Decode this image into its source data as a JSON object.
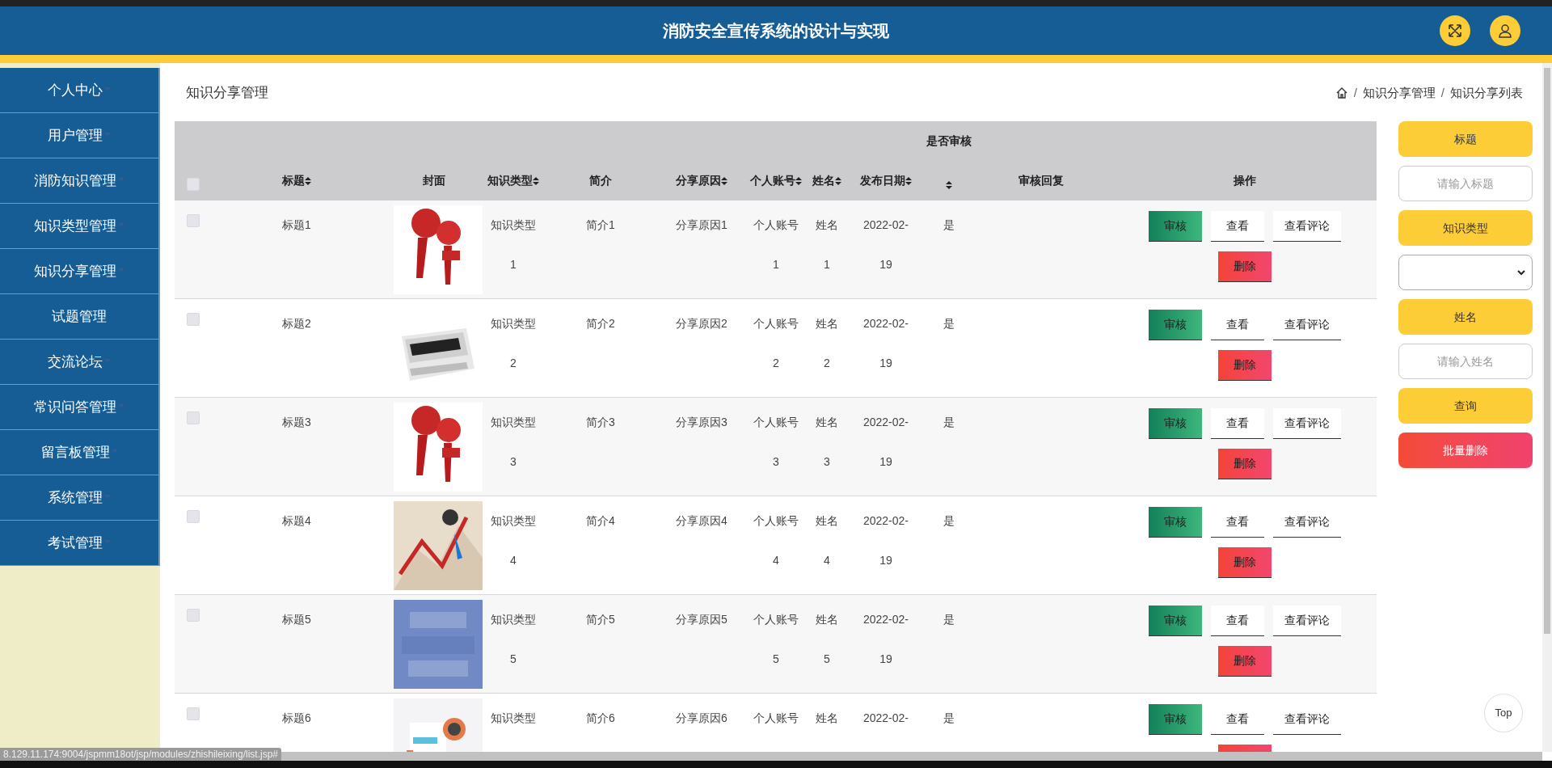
{
  "header": {
    "title": "消防安全宣传系统的设计与实现"
  },
  "sidebar": {
    "items": [
      {
        "label": "个人中心",
        "has_caret": true
      },
      {
        "label": "用户管理",
        "has_caret": true
      },
      {
        "label": "消防知识管理",
        "has_caret": true
      },
      {
        "label": "知识类型管理",
        "has_caret": true
      },
      {
        "label": "知识分享管理",
        "has_caret": true
      },
      {
        "label": "试题管理",
        "has_caret": false
      },
      {
        "label": "交流论坛",
        "has_caret": true
      },
      {
        "label": "常识问答管理",
        "has_caret": true
      },
      {
        "label": "留言板管理",
        "has_caret": true
      },
      {
        "label": "系统管理",
        "has_caret": true
      },
      {
        "label": "考试管理",
        "has_caret": true
      }
    ]
  },
  "page_title": "知识分享管理",
  "breadcrumb": [
    {
      "kind": "separator",
      "text": "/"
    },
    {
      "kind": "link",
      "text": "知识分享管理"
    },
    {
      "kind": "separator",
      "text": "/"
    },
    {
      "kind": "link",
      "text": "知识分享列表"
    }
  ],
  "table": {
    "select_all_checked": false,
    "columns": [
      {
        "label": "标题",
        "sortable": true
      },
      {
        "label": "封面",
        "sortable": false
      },
      {
        "label": "知识类型",
        "sortable": true
      },
      {
        "label": "简介",
        "sortable": false
      },
      {
        "label": "分享原因",
        "sortable": true
      },
      {
        "label": "个人账号",
        "sortable": true
      },
      {
        "label": "姓名",
        "sortable": true
      },
      {
        "label": "发布日期",
        "sortable": true
      },
      {
        "label": "是否审核",
        "sortable": true,
        "kind": "raised"
      },
      {
        "label": "审核回复",
        "sortable": false
      },
      {
        "label": "操作",
        "sortable": false
      }
    ],
    "rows": [
      {
        "checked": false,
        "title": "标题1",
        "type": "知识类型1",
        "intro": "简介1",
        "reason": "分享原因1",
        "account": "个人账号1",
        "name": "姓名1",
        "date": "2022-02-19",
        "reviewed": "是",
        "actions": [
          {
            "kind": "review",
            "label": "审核"
          },
          {
            "kind": "view",
            "label": "查看"
          },
          {
            "kind": "view",
            "label": "查看评论"
          },
          {
            "kind": "delete",
            "label": "删除"
          }
        ]
      },
      {
        "checked": false,
        "title": "标题2",
        "type": "知识类型2",
        "intro": "简介2",
        "reason": "分享原因2",
        "account": "个人账号2",
        "name": "姓名2",
        "date": "2022-02-19",
        "reviewed": "是",
        "actions": [
          {
            "kind": "review",
            "label": "审核"
          },
          {
            "kind": "view",
            "label": "查看"
          },
          {
            "kind": "view",
            "label": "查看评论"
          },
          {
            "kind": "delete",
            "label": "删除"
          }
        ]
      },
      {
        "checked": false,
        "title": "标题3",
        "type": "知识类型3",
        "intro": "简介3",
        "reason": "分享原因3",
        "account": "个人账号3",
        "name": "姓名3",
        "date": "2022-02-19",
        "reviewed": "是",
        "actions": [
          {
            "kind": "review",
            "label": "审核"
          },
          {
            "kind": "view",
            "label": "查看"
          },
          {
            "kind": "view",
            "label": "查看评论"
          },
          {
            "kind": "delete",
            "label": "删除"
          }
        ]
      },
      {
        "checked": false,
        "title": "标题4",
        "type": "知识类型4",
        "intro": "简介4",
        "reason": "分享原因4",
        "account": "个人账号4",
        "name": "姓名4",
        "date": "2022-02-19",
        "reviewed": "是",
        "actions": [
          {
            "kind": "review",
            "label": "审核"
          },
          {
            "kind": "view",
            "label": "查看"
          },
          {
            "kind": "view",
            "label": "查看评论"
          },
          {
            "kind": "delete",
            "label": "删除"
          }
        ]
      },
      {
        "checked": false,
        "title": "标题5",
        "type": "知识类型5",
        "intro": "简介5",
        "reason": "分享原因5",
        "account": "个人账号5",
        "name": "姓名5",
        "date": "2022-02-19",
        "reviewed": "是",
        "actions": [
          {
            "kind": "review",
            "label": "审核"
          },
          {
            "kind": "view",
            "label": "查看"
          },
          {
            "kind": "view",
            "label": "查看评论"
          },
          {
            "kind": "delete",
            "label": "删除"
          }
        ]
      },
      {
        "checked": false,
        "title": "标题6",
        "type": "知识类型",
        "intro": "简介6",
        "reason": "分享原因6",
        "account": "个人账号",
        "name": "姓名",
        "date": "2022-02-",
        "reviewed": "是",
        "actions": [
          {
            "kind": "review",
            "label": "审核"
          },
          {
            "kind": "view",
            "label": "查看"
          },
          {
            "kind": "view",
            "label": "查看评论"
          },
          {
            "kind": "delete"
          }
        ]
      }
    ]
  },
  "search_panel": [
    {
      "kind": "label",
      "text": "标题"
    },
    {
      "kind": "input",
      "placeholder": "请输入标题"
    },
    {
      "kind": "label",
      "text": "知识类型"
    },
    {
      "kind": "select"
    },
    {
      "kind": "label",
      "text": "姓名"
    },
    {
      "kind": "input",
      "placeholder": "请输入姓名"
    },
    {
      "kind": "search",
      "text": "查询"
    },
    {
      "kind": "danger",
      "text": "批量删除"
    }
  ],
  "top_button": "Top",
  "status_url": "8.129.11.174:9004/jspmm18ot/jsp/modules/zhishileixing/list.jsp#"
}
